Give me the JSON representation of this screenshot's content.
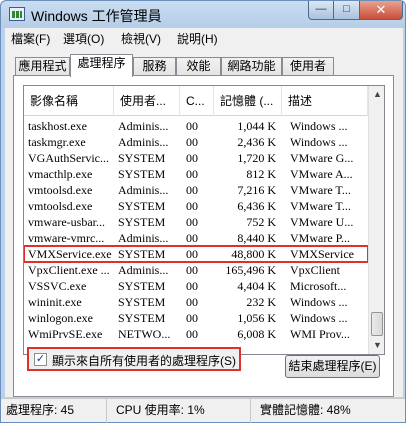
{
  "window": {
    "title": "Windows 工作管理員",
    "min_symbol": "—",
    "max_symbol": "□",
    "close_symbol": "✕"
  },
  "menu": [
    "檔案(F)",
    "選項(O)",
    "檢視(V)",
    "說明(H)"
  ],
  "tabs": [
    "應用程式",
    "處理程序",
    "服務",
    "效能",
    "網路功能",
    "使用者"
  ],
  "active_tab": "處理程序",
  "table": {
    "columns": [
      "影像名稱",
      "使用者...",
      "C...",
      "記憶體 (...",
      "描述"
    ],
    "rows": [
      [
        "taskhost.exe",
        "Adminis...",
        "00",
        "1,044 K",
        "Windows ..."
      ],
      [
        "taskmgr.exe",
        "Adminis...",
        "00",
        "2,436 K",
        "Windows ..."
      ],
      [
        "VGAuthServic...",
        "SYSTEM",
        "00",
        "1,720 K",
        "VMware G..."
      ],
      [
        "vmacthlp.exe",
        "SYSTEM",
        "00",
        "812 K",
        "VMware A..."
      ],
      [
        "vmtoolsd.exe",
        "Adminis...",
        "00",
        "7,216 K",
        "VMware T..."
      ],
      [
        "vmtoolsd.exe",
        "SYSTEM",
        "00",
        "6,436 K",
        "VMware T..."
      ],
      [
        "vmware-usbar...",
        "SYSTEM",
        "00",
        "752 K",
        "VMware U..."
      ],
      [
        "vmware-vmrc...",
        "Adminis...",
        "00",
        "8,440 K",
        "VMware P..."
      ],
      [
        "VMXService.exe",
        "SYSTEM",
        "00",
        "48,800 K",
        "VMXService"
      ],
      [
        "VpxClient.exe ...",
        "Adminis...",
        "00",
        "165,496 K",
        "VpxClient"
      ],
      [
        "VSSVC.exe",
        "SYSTEM",
        "00",
        "4,404 K",
        "Microsoft..."
      ],
      [
        "wininit.exe",
        "SYSTEM",
        "00",
        "232 K",
        "Windows ..."
      ],
      [
        "winlogon.exe",
        "SYSTEM",
        "00",
        "1,056 K",
        "Windows ..."
      ],
      [
        "WmiPrvSE.exe",
        "NETWO...",
        "00",
        "6,008 K",
        "WMI Prov..."
      ]
    ],
    "selected_row": "VMXService.exe"
  },
  "show_all_checked": "✓",
  "show_all_label": "顯示來自所有使用者的處理程序(S)",
  "end_process_button": "結束處理程序(E)",
  "status": {
    "processes": "處理程序: 45",
    "cpu": "CPU 使用率: 1%",
    "memory": "實體記憶體: 48%"
  },
  "colors": {
    "highlight": "#e0302e",
    "frame": "#b9d1ea"
  },
  "icons": [
    "app-icon",
    "checkbox-checked-icon",
    "scroll-up-icon",
    "scroll-down-icon"
  ]
}
